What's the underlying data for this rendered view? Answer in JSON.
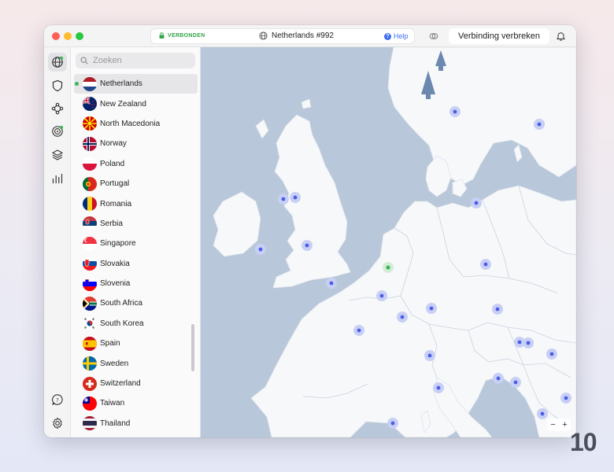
{
  "titlebar": {
    "status": "VERBONDEN",
    "server": "Netherlands #992",
    "help": "Help",
    "disconnect": "Verbinding verbreken"
  },
  "search": {
    "placeholder": "Zoeken"
  },
  "countries": [
    {
      "name": "Netherlands",
      "flag": "nl",
      "selected": true
    },
    {
      "name": "New Zealand",
      "flag": "nz"
    },
    {
      "name": "North Macedonia",
      "flag": "mk"
    },
    {
      "name": "Norway",
      "flag": "no"
    },
    {
      "name": "Poland",
      "flag": "pl"
    },
    {
      "name": "Portugal",
      "flag": "pt"
    },
    {
      "name": "Romania",
      "flag": "ro"
    },
    {
      "name": "Serbia",
      "flag": "rs"
    },
    {
      "name": "Singapore",
      "flag": "sg"
    },
    {
      "name": "Slovakia",
      "flag": "sk"
    },
    {
      "name": "Slovenia",
      "flag": "si"
    },
    {
      "name": "South Africa",
      "flag": "za"
    },
    {
      "name": "South Korea",
      "flag": "kr"
    },
    {
      "name": "Spain",
      "flag": "es"
    },
    {
      "name": "Sweden",
      "flag": "se"
    },
    {
      "name": "Switzerland",
      "flag": "ch"
    },
    {
      "name": "Taiwan",
      "flag": "tw"
    },
    {
      "name": "Thailand",
      "flag": "th"
    }
  ],
  "rail_icons": [
    "globe-icon",
    "shield-icon",
    "meshnet-icon",
    "target-icon",
    "layers-icon",
    "stats-icon",
    "help-circle-icon",
    "settings-icon"
  ],
  "map": {
    "zoom_out": "−",
    "zoom_in": "+"
  },
  "brand": {
    "number": "10"
  },
  "colors": {
    "accent": "#3c6cf0",
    "connected": "#35a44a",
    "sea": "#b8c7d9",
    "land": "#f7f8fa"
  }
}
